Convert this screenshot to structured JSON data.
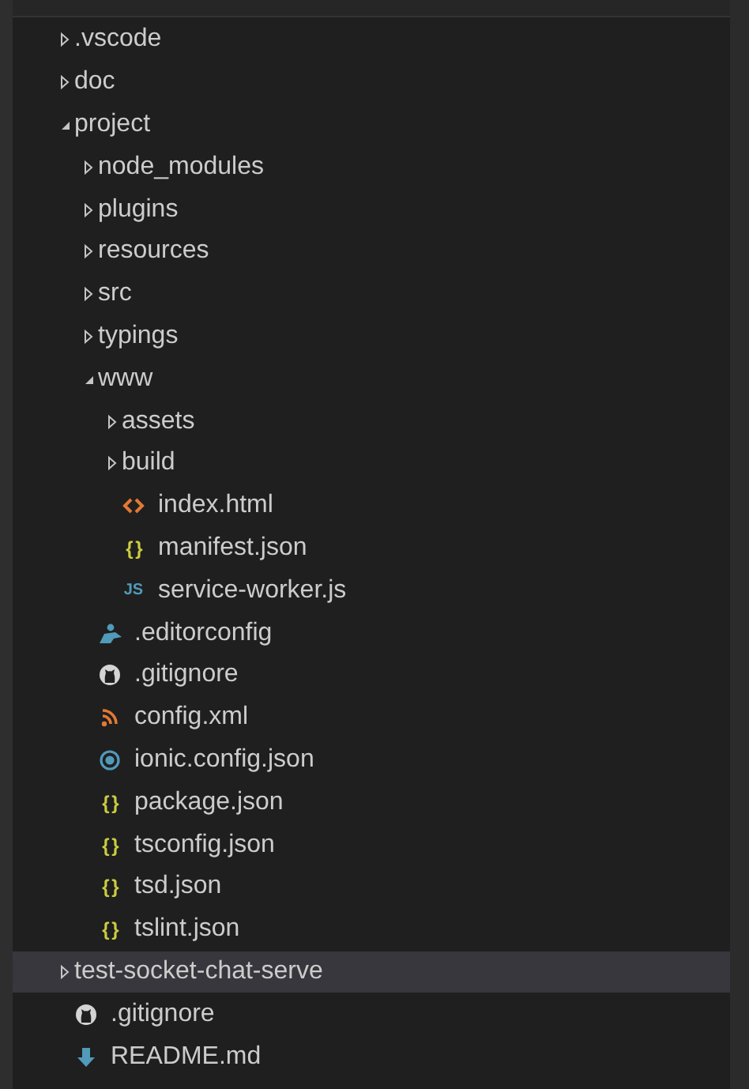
{
  "tree": [
    {
      "kind": "folder",
      "name": ".vscode",
      "expanded": false,
      "selected": false
    },
    {
      "kind": "folder",
      "name": "doc",
      "expanded": false,
      "selected": false
    },
    {
      "kind": "folder",
      "name": "project",
      "expanded": true,
      "selected": false,
      "children": [
        {
          "kind": "folder",
          "name": "node_modules",
          "expanded": false,
          "selected": false
        },
        {
          "kind": "folder",
          "name": "plugins",
          "expanded": false,
          "selected": false
        },
        {
          "kind": "folder",
          "name": "resources",
          "expanded": false,
          "selected": false
        },
        {
          "kind": "folder",
          "name": "src",
          "expanded": false,
          "selected": false
        },
        {
          "kind": "folder",
          "name": "typings",
          "expanded": false,
          "selected": false
        },
        {
          "kind": "folder",
          "name": "www",
          "expanded": true,
          "selected": false,
          "children": [
            {
              "kind": "folder",
              "name": "assets",
              "expanded": false,
              "selected": false
            },
            {
              "kind": "folder",
              "name": "build",
              "expanded": false,
              "selected": false
            },
            {
              "kind": "html",
              "name": "index.html",
              "selected": false
            },
            {
              "kind": "json",
              "badge": "{ }",
              "name": "manifest.json",
              "selected": false
            },
            {
              "kind": "js",
              "badge": "JS",
              "name": "service-worker.js",
              "selected": false
            }
          ]
        },
        {
          "kind": "editorconfig",
          "name": ".editorconfig",
          "selected": false
        },
        {
          "kind": "git",
          "name": ".gitignore",
          "selected": false
        },
        {
          "kind": "xml",
          "name": "config.xml",
          "selected": false
        },
        {
          "kind": "ionic",
          "name": "ionic.config.json",
          "selected": false
        },
        {
          "kind": "json",
          "badge": "{ }",
          "name": "package.json",
          "selected": false
        },
        {
          "kind": "json",
          "badge": "{ }",
          "name": "tsconfig.json",
          "selected": false
        },
        {
          "kind": "json",
          "badge": "{ }",
          "name": "tsd.json",
          "selected": false
        },
        {
          "kind": "json",
          "badge": "{ }",
          "name": "tslint.json",
          "selected": false
        }
      ]
    },
    {
      "kind": "folder",
      "name": "test-socket-chat-serve",
      "expanded": false,
      "selected": true
    },
    {
      "kind": "git",
      "name": ".gitignore",
      "selected": false
    },
    {
      "kind": "markdown",
      "name": "README.md",
      "selected": false
    }
  ]
}
